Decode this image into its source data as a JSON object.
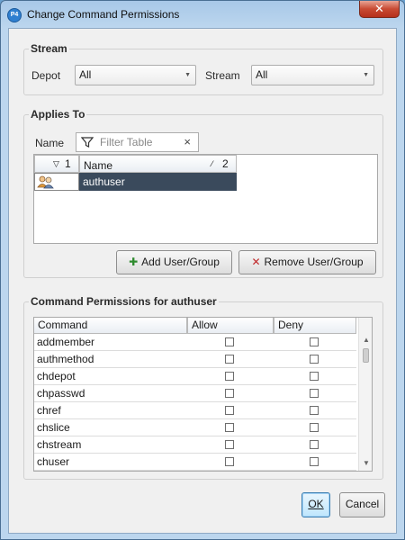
{
  "window": {
    "title": "Change Command Permissions",
    "close_symbol": "✕",
    "app_icon_label": "P4"
  },
  "stream_section": {
    "title": "Stream",
    "depot_label": "Depot",
    "depot_value": "All",
    "stream_label": "Stream",
    "stream_value": "All"
  },
  "applies_to": {
    "title": "Applies To",
    "name_label": "Name",
    "filter_placeholder": "Filter Table",
    "columns": [
      {
        "label": "1",
        "sort_glyph": "▽"
      },
      {
        "label": "Name",
        "sort_glyph": "⁄",
        "num": "2"
      }
    ],
    "rows": [
      {
        "name": "authuser",
        "type": "user-group"
      }
    ],
    "add_button": "Add User/Group",
    "remove_button": "Remove User/Group"
  },
  "permissions": {
    "title": "Command Permissions for authuser",
    "columns": [
      "Command",
      "Allow",
      "Deny"
    ],
    "rows": [
      {
        "command": "addmember",
        "allow": false,
        "deny": false
      },
      {
        "command": "authmethod",
        "allow": false,
        "deny": false
      },
      {
        "command": "chdepot",
        "allow": false,
        "deny": false
      },
      {
        "command": "chpasswd",
        "allow": false,
        "deny": false
      },
      {
        "command": "chref",
        "allow": false,
        "deny": false
      },
      {
        "command": "chslice",
        "allow": false,
        "deny": false
      },
      {
        "command": "chstream",
        "allow": false,
        "deny": false
      },
      {
        "command": "chuser",
        "allow": false,
        "deny": false
      }
    ]
  },
  "footer": {
    "ok_label": "OK",
    "cancel_label": "Cancel"
  },
  "colors": {
    "selection": "#3a4a5c",
    "accent": "#2f7fd0",
    "remove_red": "#c0282a"
  }
}
